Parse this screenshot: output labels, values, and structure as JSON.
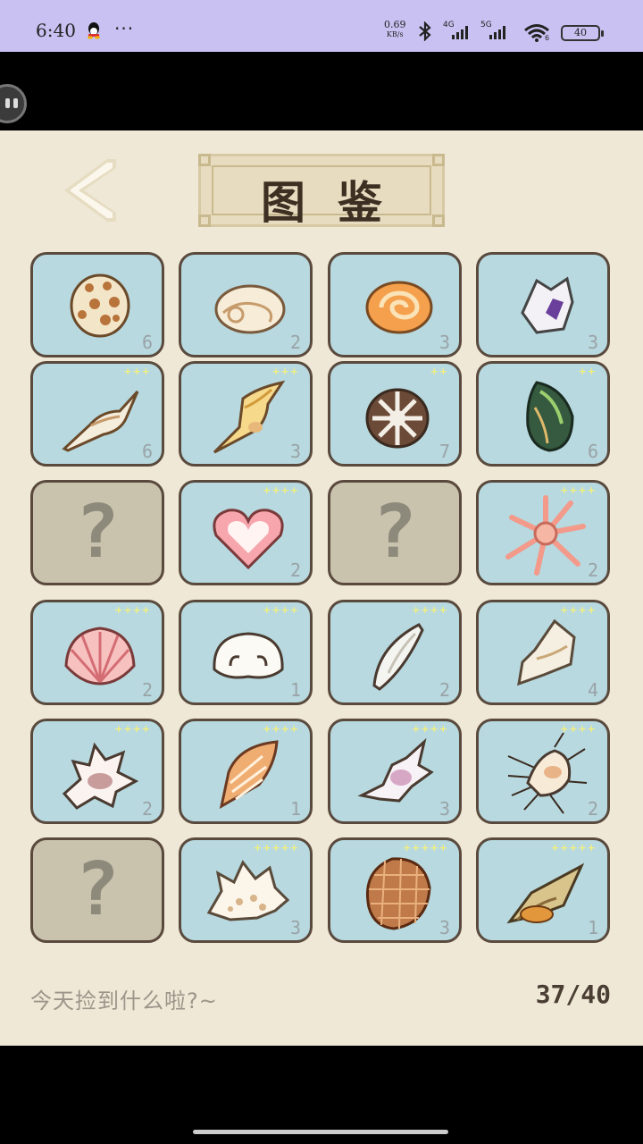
{
  "status_bar": {
    "time": "6:40",
    "more": "···",
    "net_speed_value": "0.69",
    "net_speed_unit": "KB/s",
    "signal1_label": "4G",
    "signal2_label": "5G",
    "wifi_label": "6",
    "battery": "40",
    "icons": [
      "qq-icon",
      "bluetooth-icon",
      "signal-icon",
      "wifi-icon",
      "battery-icon"
    ]
  },
  "header": {
    "title": "图鉴",
    "back_icon": "chevron-left-icon"
  },
  "collection": {
    "rows": [
      [
        {
          "stars": "",
          "count": "6",
          "icon": "cowrie-shell-icon",
          "locked": false
        },
        {
          "stars": "",
          "count": "2",
          "icon": "white-snail-shell-icon",
          "locked": false
        },
        {
          "stars": "",
          "count": "3",
          "icon": "orange-nautilus-shell-icon",
          "locked": false
        },
        {
          "stars": "",
          "count": "3",
          "icon": "purple-murex-shell-icon",
          "locked": false
        }
      ],
      [
        {
          "stars": "+++",
          "count": "6",
          "icon": "spindle-shell-icon",
          "locked": false
        },
        {
          "stars": "+++",
          "count": "3",
          "icon": "yellow-spider-conch-icon",
          "locked": false
        },
        {
          "stars": "++",
          "count": "7",
          "icon": "sea-urchin-icon",
          "locked": false
        },
        {
          "stars": "++",
          "count": "6",
          "icon": "green-mussel-icon",
          "locked": false
        }
      ],
      [
        {
          "stars": "",
          "count": "",
          "icon": "question-mark-icon",
          "locked": true
        },
        {
          "stars": "++++",
          "count": "2",
          "icon": "heart-shell-icon",
          "locked": false
        },
        {
          "stars": "",
          "count": "",
          "icon": "question-mark-icon",
          "locked": true
        },
        {
          "stars": "++++",
          "count": "2",
          "icon": "starfish-icon",
          "locked": false
        }
      ],
      [
        {
          "stars": "++++",
          "count": "2",
          "icon": "pink-scallop-icon",
          "locked": false
        },
        {
          "stars": "++++",
          "count": "1",
          "icon": "white-bonnet-shell-icon",
          "locked": false
        },
        {
          "stars": "++++",
          "count": "2",
          "icon": "olive-shell-icon",
          "locked": false
        },
        {
          "stars": "++++",
          "count": "4",
          "icon": "white-conch-icon",
          "locked": false
        }
      ],
      [
        {
          "stars": "++++",
          "count": "2",
          "icon": "spiny-murex-icon",
          "locked": false
        },
        {
          "stars": "++++",
          "count": "1",
          "icon": "orange-cone-shell-icon",
          "locked": false
        },
        {
          "stars": "++++",
          "count": "3",
          "icon": "pink-spider-conch-icon",
          "locked": false
        },
        {
          "stars": "++++",
          "count": "2",
          "icon": "venus-comb-murex-icon",
          "locked": false
        }
      ],
      [
        {
          "stars": "",
          "count": "",
          "icon": "question-mark-icon",
          "locked": true
        },
        {
          "stars": "+++++",
          "count": "3",
          "icon": "white-crown-shell-icon",
          "locked": false
        },
        {
          "stars": "+++++",
          "count": "3",
          "icon": "brown-textile-shell-icon",
          "locked": false
        },
        {
          "stars": "+++++",
          "count": "1",
          "icon": "whelk-shell-icon",
          "locked": false
        }
      ]
    ],
    "locked_glyph": "?"
  },
  "footer": {
    "message": "今天捡到什么啦?~",
    "progress": "37/40"
  }
}
